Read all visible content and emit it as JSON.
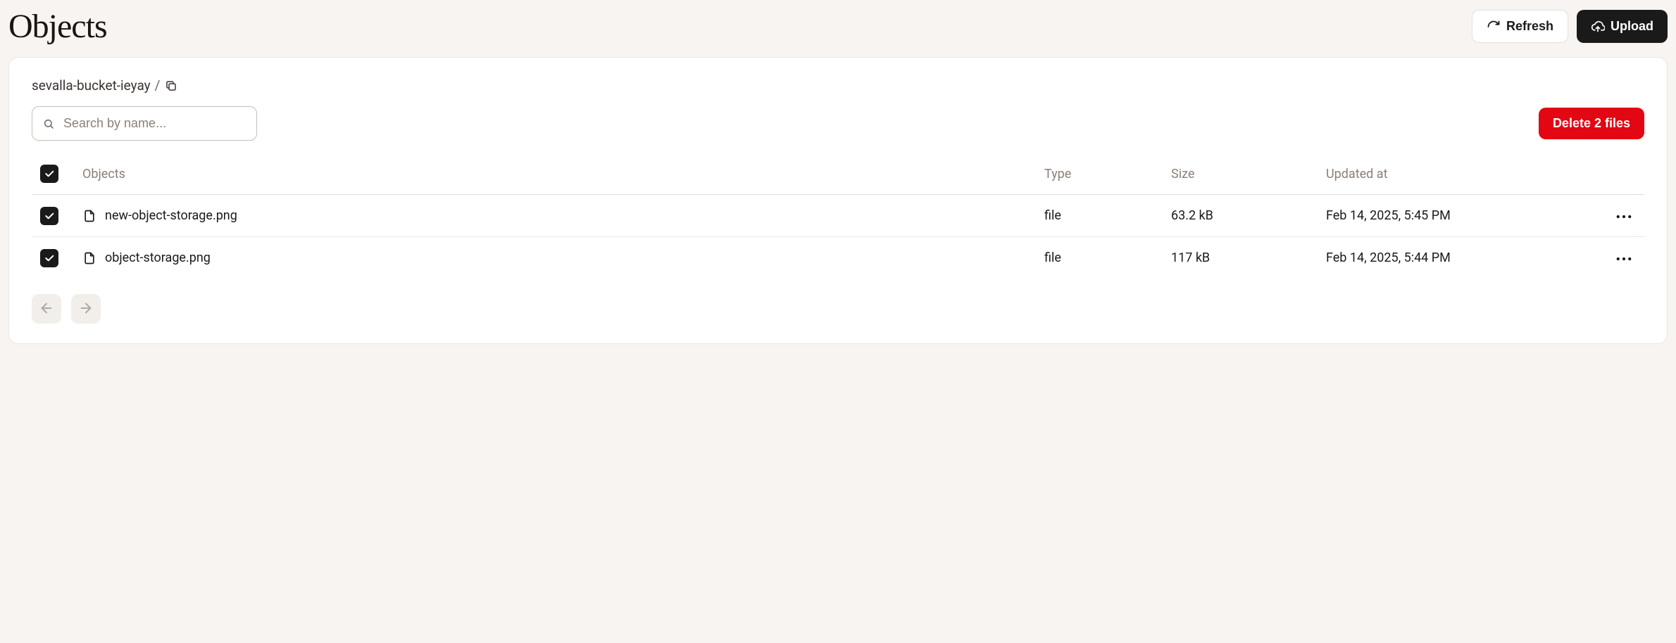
{
  "header": {
    "title": "Objects",
    "refresh_label": "Refresh",
    "upload_label": "Upload"
  },
  "breadcrumb": {
    "bucket": "sevalla-bucket-ieyay",
    "separator": "/"
  },
  "search": {
    "placeholder": "Search by name..."
  },
  "toolbar": {
    "delete_label": "Delete 2 files"
  },
  "table": {
    "columns": {
      "objects": "Objects",
      "type": "Type",
      "size": "Size",
      "updated_at": "Updated at"
    },
    "rows": [
      {
        "selected": true,
        "name": "new-object-storage.png",
        "type": "file",
        "size": "63.2 kB",
        "updated_at": "Feb 14, 2025, 5:45 PM"
      },
      {
        "selected": true,
        "name": "object-storage.png",
        "type": "file",
        "size": "117 kB",
        "updated_at": "Feb 14, 2025, 5:44 PM"
      }
    ]
  }
}
